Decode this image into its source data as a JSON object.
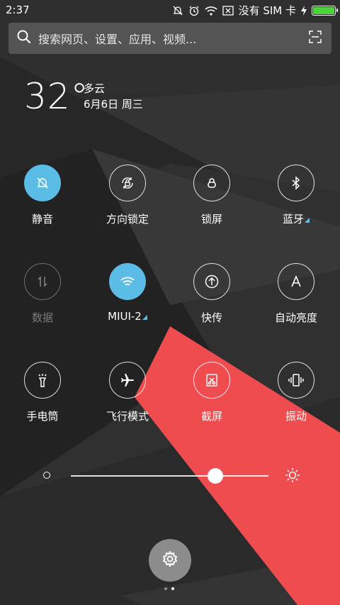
{
  "status_bar": {
    "time": "2:37",
    "sim_text": "没有 SIM 卡",
    "battery_level": 1.0,
    "icons": [
      "mute-bell-icon",
      "alarm-icon",
      "wifi-icon",
      "no-sim-icon",
      "charging-icon",
      "battery-icon"
    ]
  },
  "search": {
    "placeholder": "搜索网页、设置、应用、视频...",
    "icon": "search-icon",
    "scan_icon": "scan-icon"
  },
  "weather": {
    "temperature": "32°",
    "condition": "多云",
    "date": "6月6日 周三"
  },
  "toggles": [
    {
      "label": "静音",
      "icon": "mute-bell-icon",
      "state": "on"
    },
    {
      "label": "方向锁定",
      "icon": "rotation-lock-icon",
      "state": "off"
    },
    {
      "label": "锁屏",
      "icon": "lock-icon",
      "state": "off"
    },
    {
      "label": "蓝牙",
      "icon": "bluetooth-icon",
      "state": "off"
    },
    {
      "label": "数据",
      "icon": "data-icon",
      "state": "disabled"
    },
    {
      "label": "MIUI-2",
      "icon": "wifi-icon",
      "state": "on"
    },
    {
      "label": "快传",
      "icon": "share-icon",
      "state": "off"
    },
    {
      "label": "自动亮度",
      "icon": "auto-brightness-icon",
      "state": "off"
    },
    {
      "label": "手电筒",
      "icon": "flashlight-icon",
      "state": "off"
    },
    {
      "label": "飞行模式",
      "icon": "airplane-icon",
      "state": "off"
    },
    {
      "label": "截屏",
      "icon": "screenshot-icon",
      "state": "off"
    },
    {
      "label": "振动",
      "icon": "vibrate-icon",
      "state": "off"
    }
  ],
  "brightness": {
    "level": 0.73
  },
  "pager": {
    "count": 2,
    "active": 1
  },
  "colors": {
    "accent": "#5bbde6",
    "battery": "#4cd33c",
    "red_band": "#ee4c4f"
  }
}
